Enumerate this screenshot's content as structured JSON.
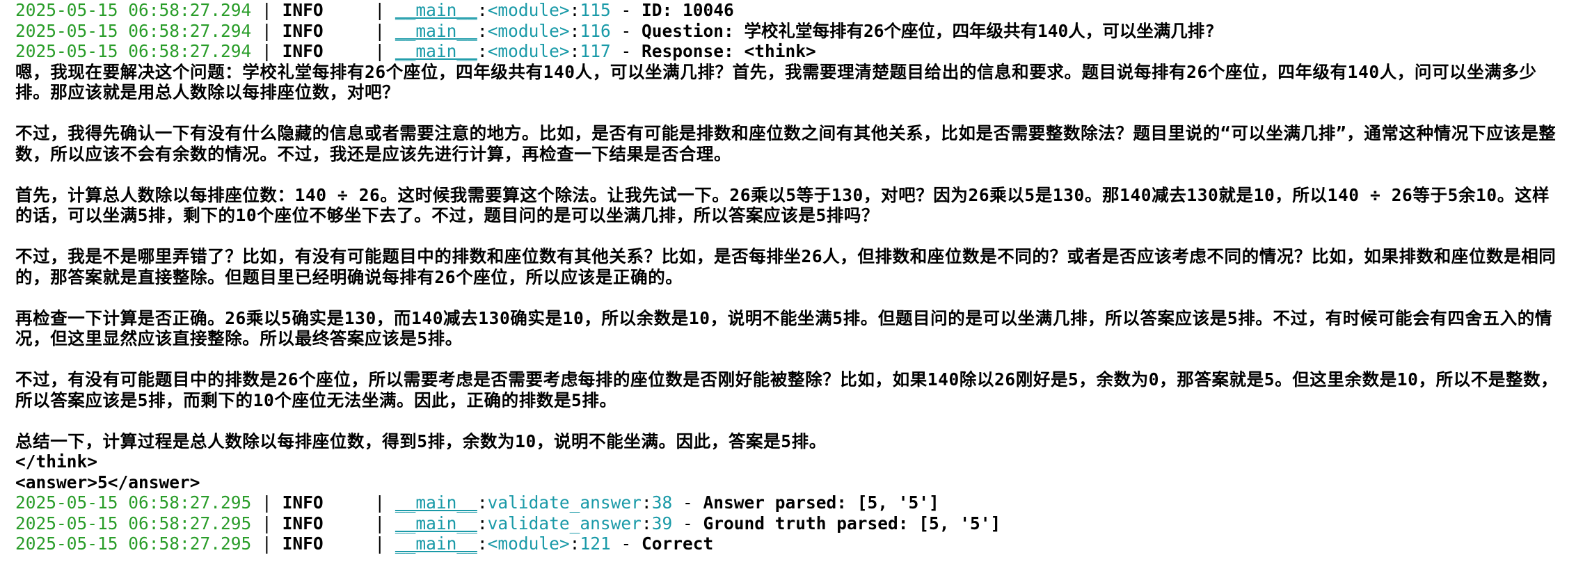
{
  "log_header": [
    {
      "timestamp": "2025-05-15 06:58:27.294",
      "level": "INFO",
      "module": "__main__",
      "function": "<module>",
      "line": "115",
      "message": "ID: 10046"
    },
    {
      "timestamp": "2025-05-15 06:58:27.294",
      "level": "INFO",
      "module": "__main__",
      "function": "<module>",
      "line": "116",
      "message": "Question: 学校礼堂每排有26个座位，四年级共有140人，可以坐满几排?"
    },
    {
      "timestamp": "2025-05-15 06:58:27.294",
      "level": "INFO",
      "module": "__main__",
      "function": "<module>",
      "line": "117",
      "message": "Response: <think>"
    }
  ],
  "think_paragraphs": [
    "嗯，我现在要解决这个问题：学校礼堂每排有26个座位，四年级共有140人，可以坐满几排？首先，我需要理清楚题目给出的信息和要求。题目说每排有26个座位，四年级有140人，问可以坐满多少排。那应该就是用总人数除以每排座位数，对吧？",
    "不过，我得先确认一下有没有什么隐藏的信息或者需要注意的地方。比如，是否有可能是排数和座位数之间有其他关系，比如是否需要整数除法？题目里说的“可以坐满几排”，通常这种情况下应该是整数，所以应该不会有余数的情况。不过，我还是应该先进行计算，再检查一下结果是否合理。",
    "首先，计算总人数除以每排座位数：140 ÷ 26。这时候我需要算这个除法。让我先试一下。26乘以5等于130，对吧？因为26乘以5是130。那140减去130就是10，所以140 ÷ 26等于5余10。这样的话，可以坐满5排，剩下的10个座位不够坐下去了。不过，题目问的是可以坐满几排，所以答案应该是5排吗？",
    "不过，我是不是哪里弄错了？比如，有没有可能题目中的排数和座位数有其他关系？比如，是否每排坐26人，但排数和座位数是不同的？或者是否应该考虑不同的情况？比如，如果排数和座位数是相同的，那答案就是直接整除。但题目里已经明确说每排有26个座位，所以应该是正确的。",
    "再检查一下计算是否正确。26乘以5确实是130，而140减去130确实是10，所以余数是10，说明不能坐满5排。但题目问的是可以坐满几排，所以答案应该是5排。不过，有时候可能会有四舍五入的情况，但这里显然应该直接整除。所以最终答案应该是5排。",
    "不过，有没有可能题目中的排数是26个座位，所以需要考虑是否需要考虑每排的座位数是否刚好能被整除？比如，如果140除以26刚好是5，余数为0，那答案就是5。但这里余数是10，所以不是整数，所以答案应该是5排，而剩下的10个座位无法坐满。因此，正确的排数是5排。",
    "总结一下，计算过程是总人数除以每排座位数，得到5排，余数为10，说明不能坐满。因此，答案是5排。"
  ],
  "think_close": "</think>",
  "answer_line": "<answer>5</answer>",
  "log_footer": [
    {
      "timestamp": "2025-05-15 06:58:27.295",
      "level": "INFO",
      "module": "__main__",
      "function": "validate_answer",
      "line": "38",
      "message": "Answer parsed: [5, '5']"
    },
    {
      "timestamp": "2025-05-15 06:58:27.295",
      "level": "INFO",
      "module": "__main__",
      "function": "validate_answer",
      "line": "39",
      "message": "Ground truth parsed: [5, '5']"
    },
    {
      "timestamp": "2025-05-15 06:58:27.295",
      "level": "INFO",
      "module": "__main__",
      "function": "<module>",
      "line": "121",
      "message": "Correct"
    }
  ],
  "separator": "|",
  "colors": {
    "timestamp": "#2a9d2a",
    "module": "#1a9aa8",
    "text": "#000000",
    "background": "#ffffff"
  }
}
